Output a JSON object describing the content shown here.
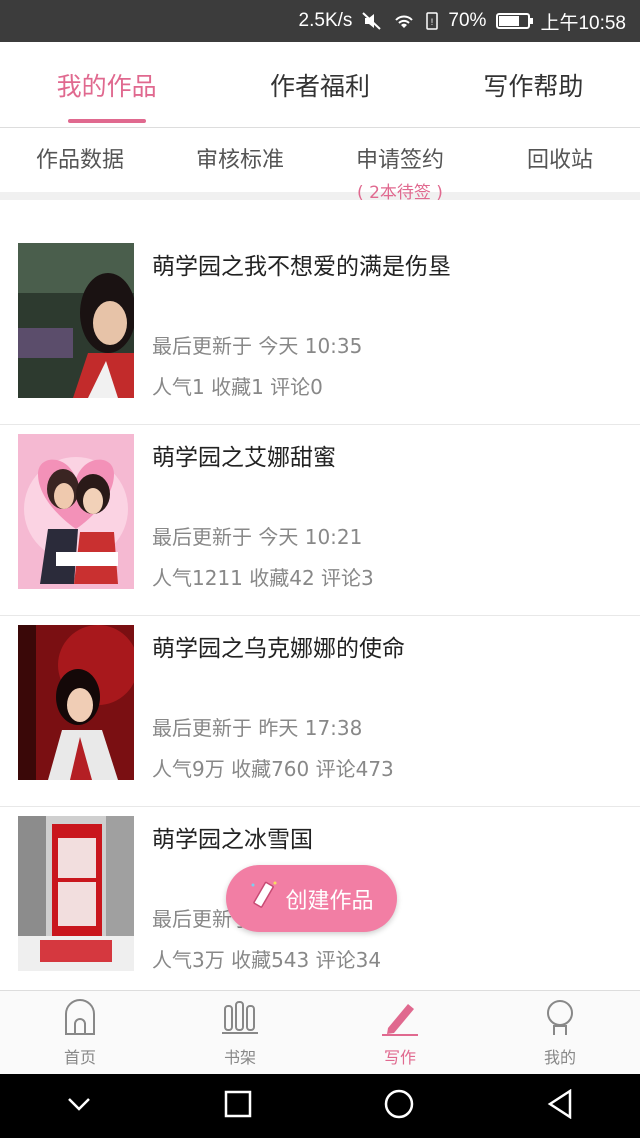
{
  "status": {
    "speed": "2.5K/s",
    "battery_percent": 70,
    "battery_text": "70%",
    "time": "上午10:58"
  },
  "tabs": [
    {
      "label": "我的作品",
      "active": true
    },
    {
      "label": "作者福利",
      "active": false
    },
    {
      "label": "写作帮助",
      "active": false
    }
  ],
  "submenu": [
    {
      "label": "作品数据",
      "note": ""
    },
    {
      "label": "审核标准",
      "note": ""
    },
    {
      "label": "申请签约",
      "note": "( 2本待签 )"
    },
    {
      "label": "回收站",
      "note": ""
    }
  ],
  "books": [
    {
      "title": "萌学园之我不想爱的满是伤垦",
      "updated": "最后更新于 今天 10:35",
      "stats": "人气1  收藏1  评论0"
    },
    {
      "title": "萌学园之艾娜甜蜜",
      "updated": "最后更新于 今天 10:21",
      "stats": "人气1211  收藏42  评论3"
    },
    {
      "title": "萌学园之乌克娜娜的使命",
      "updated": "最后更新于 昨天 17:38",
      "stats": "人气9万  收藏760  评论473"
    },
    {
      "title": "萌学园之冰雪国",
      "updated": "最后更新于 今天 10:01",
      "stats": "人气3万  收藏543  评论34"
    }
  ],
  "fab": {
    "label": "创建作品"
  },
  "bottom_nav": [
    {
      "label": "首页",
      "icon": "home-icon",
      "active": false
    },
    {
      "label": "书架",
      "icon": "bookshelf-icon",
      "active": false
    },
    {
      "label": "写作",
      "icon": "pencil-icon",
      "active": true
    },
    {
      "label": "我的",
      "icon": "profile-icon",
      "active": false
    }
  ],
  "colors": {
    "accent": "#e0698f",
    "fab": "#f27ea4"
  }
}
